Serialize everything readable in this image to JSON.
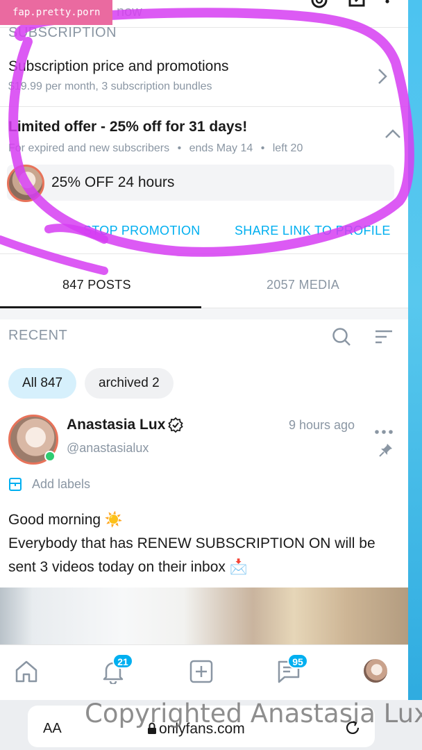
{
  "watermark": "fap.pretty.porn",
  "top": {
    "partial_text": "now"
  },
  "subscription": {
    "section_label": "SUBSCRIPTION",
    "title": "Subscription price and promotions",
    "details": "$19.99 per month, 3 subscription bundles"
  },
  "offer": {
    "title": "Limited offer - 25% off for 31 days!",
    "audience": "For expired and new subscribers",
    "ends": "ends May 14",
    "left": "left 20",
    "separator": "•",
    "promo_label": "25% OFF 24 hours",
    "stop_label": "STOP PROMOTION",
    "share_label": "SHARE LINK TO PROFILE"
  },
  "tabs": [
    {
      "label": "847 POSTS",
      "active": true
    },
    {
      "label": "2057 MEDIA",
      "active": false
    }
  ],
  "recent": {
    "label": "RECENT",
    "chips": [
      {
        "label": "All 847",
        "active": true
      },
      {
        "label": "archived 2",
        "active": false
      }
    ]
  },
  "post": {
    "name": "Anastasia Lux",
    "handle": "@anastasialux",
    "time": "9 hours ago",
    "add_labels": "Add labels",
    "line1": "Good morning ☀️",
    "line2": "Everybody that has RENEW SUBSCRIPTION ON will be sent 3 videos today on their inbox 📩"
  },
  "nav": {
    "icons": [
      "home-icon",
      "notifications-icon",
      "add-post-icon",
      "messages-icon",
      "profile-avatar"
    ],
    "notifications_badge": "21",
    "messages_badge": "95"
  },
  "browser": {
    "aa_label": "AA",
    "url": "onlyfans.com"
  },
  "copyright": "Copyrighted Anastasia Lux",
  "colors": {
    "accent": "#00aff0",
    "scribble": "#d63df2",
    "muted_text": "#8a96a3",
    "online": "#2ecc71"
  }
}
